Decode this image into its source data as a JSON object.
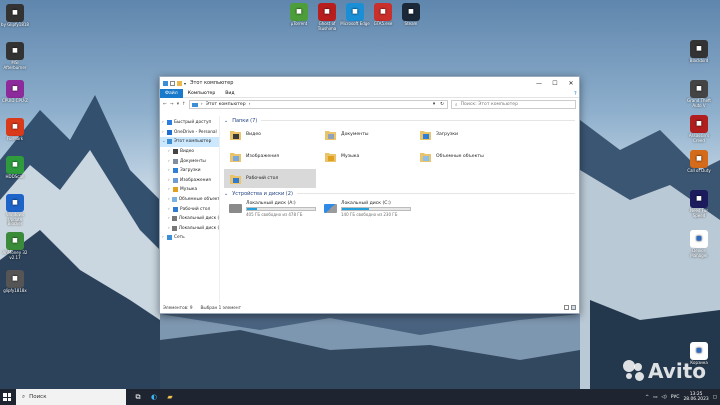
{
  "desktop": {
    "left_icons": [
      {
        "label": "by Glipfy1818",
        "icon": "app-icon",
        "color": "#333333"
      },
      {
        "label": "MSI Afterburner",
        "icon": "afterburner-icon",
        "color": "#333333"
      },
      {
        "label": "CPUID CPU-Z",
        "icon": "cpuz-icon",
        "color": "#8e2b9c"
      },
      {
        "label": "FurMark",
        "icon": "furmark-icon",
        "color": "#d93a1a"
      },
      {
        "label": "HDDScan",
        "icon": "hddscan-icon",
        "color": "#2e9c3c"
      },
      {
        "label": "Windows Update Blocker",
        "icon": "wub-icon",
        "color": "#1d63c8"
      },
      {
        "label": "AnMoney 32 v2.17",
        "icon": "anmoney-icon",
        "color": "#3a8c3a"
      },
      {
        "label": "glipfy1818x",
        "icon": "app-icon",
        "color": "#555555"
      }
    ],
    "top_icons": [
      {
        "label": "μTorrent",
        "icon": "utorrent-icon",
        "color": "#4d9e3a"
      },
      {
        "label": "Ghost of Tsushima",
        "icon": "game-icon",
        "color": "#b81e1e"
      },
      {
        "label": "Microsoft Edge",
        "icon": "edge-icon",
        "color": "#1b8fd6"
      },
      {
        "label": "GTA5.exe",
        "icon": "gta-icon",
        "color": "#c9302c"
      },
      {
        "label": "Steam",
        "icon": "steam-icon",
        "color": "#1b2838"
      }
    ],
    "right_icons": [
      {
        "label": "Blackbird",
        "icon": "blackbird-icon",
        "color": "#333333"
      },
      {
        "label": "Grand Theft Auto V",
        "icon": "gta-icon",
        "color": "#444444"
      },
      {
        "label": "Assassin's Creed",
        "icon": "ac-icon",
        "color": "#b01e1e"
      },
      {
        "label": "Call of Duty",
        "icon": "cod-icon",
        "color": "#d46b1a"
      },
      {
        "label": "Need For Speed",
        "icon": "nfs-icon",
        "color": "#1b1b5e"
      },
      {
        "label": "Device Manager",
        "icon": "device-manager-icon",
        "color": "#ffffff"
      },
      {
        "label": "Корзина",
        "icon": "recycle-bin-icon",
        "color": "#ffffff"
      }
    ]
  },
  "window": {
    "title": "Этот компьютер",
    "controls": [
      "—",
      "☐",
      "✕"
    ],
    "ribbon": {
      "tabs": [
        "Файл",
        "Компьютер",
        "Вид"
      ]
    },
    "address": {
      "path": "Этот компьютер",
      "chevron": "›"
    },
    "search": {
      "placeholder": "Поиск: Этот компьютер"
    },
    "sidebar": [
      {
        "label": "Быстрый доступ",
        "icon": "star-icon",
        "color": "#2b7de0",
        "indent": 0
      },
      {
        "label": "OneDrive - Personal",
        "icon": "onedrive-icon",
        "color": "#1e6fd1",
        "indent": 0
      },
      {
        "label": "Этот компьютер",
        "icon": "computer-icon",
        "color": "#3c8fd7",
        "indent": 0,
        "selected": true
      },
      {
        "label": "Видео",
        "icon": "video-folder-icon",
        "color": "#444444",
        "indent": 1
      },
      {
        "label": "Документы",
        "icon": "documents-folder-icon",
        "color": "#7f8ea3",
        "indent": 1
      },
      {
        "label": "Загрузки",
        "icon": "downloads-folder-icon",
        "color": "#2e7fd8",
        "indent": 1
      },
      {
        "label": "Изображения",
        "icon": "pictures-folder-icon",
        "color": "#6c9bd6",
        "indent": 1
      },
      {
        "label": "Музыка",
        "icon": "music-folder-icon",
        "color": "#e0a020",
        "indent": 1
      },
      {
        "label": "Объемные объекты",
        "icon": "3d-objects-icon",
        "color": "#7bb2e0",
        "indent": 1
      },
      {
        "label": "Рабочий стол",
        "icon": "desktop-folder-icon",
        "color": "#2f7ad2",
        "indent": 1
      },
      {
        "label": "Локальный диск (A:",
        "icon": "drive-icon",
        "color": "#777777",
        "indent": 1
      },
      {
        "label": "Локальный диск (C:",
        "icon": "drive-icon",
        "color": "#777777",
        "indent": 1
      },
      {
        "label": "Сеть",
        "icon": "network-icon",
        "color": "#3c8fd7",
        "indent": 0
      }
    ],
    "folders_header": "Папки (7)",
    "folders": [
      {
        "label": "Видео",
        "icon": "video-folder-icon"
      },
      {
        "label": "Документы",
        "icon": "documents-folder-icon"
      },
      {
        "label": "Загрузки",
        "icon": "downloads-folder-icon"
      },
      {
        "label": "Изображения",
        "icon": "pictures-folder-icon"
      },
      {
        "label": "Музыка",
        "icon": "music-folder-icon"
      },
      {
        "label": "Объемные объекты",
        "icon": "3d-objects-icon"
      },
      {
        "label": "Рабочий стол",
        "icon": "desktop-folder-icon",
        "selected": true
      }
    ],
    "drives_header": "Устройства и диски (2)",
    "drives": [
      {
        "label": "Локальный диск (A:)",
        "free": "405 ГБ свободно из 478 ГБ",
        "used_fraction": 0.15,
        "icon": "hdd-icon"
      },
      {
        "label": "Локальный диск (C:)",
        "free": "140 ГБ свободно из 230 ГБ",
        "used_fraction": 0.39,
        "icon": "windows-drive-icon"
      }
    ],
    "status": {
      "items": "Элементов: 9",
      "selected": "Выбран 1 элемент"
    }
  },
  "taskbar": {
    "search_label": "Поиск",
    "apps": [
      {
        "icon": "task-view-icon",
        "glyph": "⧉"
      },
      {
        "icon": "edge-icon",
        "glyph": "◐"
      },
      {
        "icon": "file-explorer-icon",
        "glyph": "▰"
      }
    ],
    "tray": {
      "chevron": "^",
      "language": "РУС",
      "time": "13:25",
      "date": "28.06.2023"
    }
  },
  "watermark": "Avito"
}
